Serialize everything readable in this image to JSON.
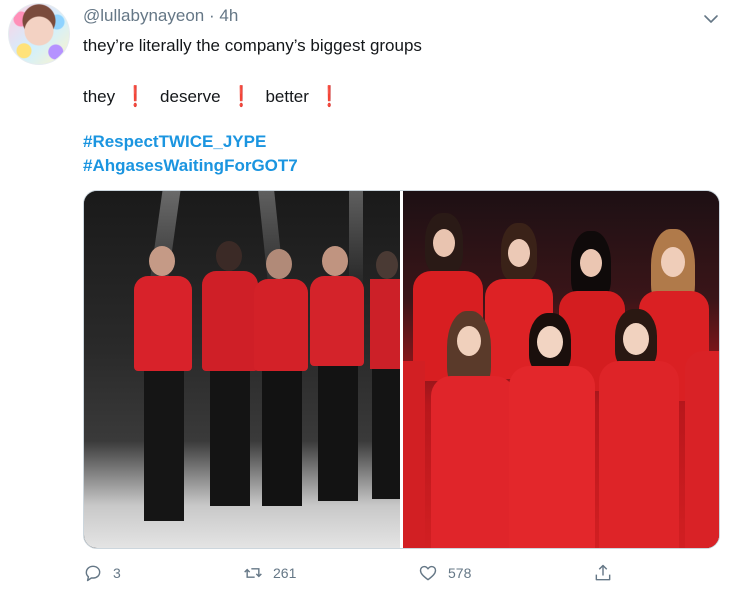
{
  "tweet": {
    "handle": "@lullabynayeon",
    "separator": "·",
    "time": "4h",
    "text_line1": "they’re literally the company’s biggest groups",
    "text_line2_words": [
      "they",
      "deserve",
      "better"
    ],
    "bang": "❗",
    "hashtags": [
      "#RespectTWICE_JYPE",
      "#AhgasesWaitingForGOT7"
    ]
  },
  "actions": {
    "reply_count": "3",
    "retweet_count": "261",
    "like_count": "578"
  },
  "colors": {
    "hashtag": "#1b95e0",
    "muted": "#657786",
    "text": "#14171a",
    "accent_red": "#e0212b"
  }
}
